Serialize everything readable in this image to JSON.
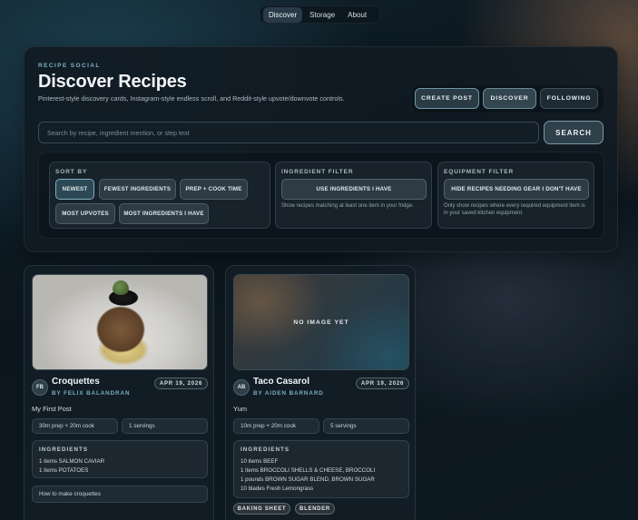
{
  "nav": {
    "items": [
      "Discover",
      "Storage",
      "About"
    ],
    "active": "Discover"
  },
  "hero": {
    "eyebrow": "RECIPE SOCIAL",
    "title": "Discover Recipes",
    "subtitle": "Pinterest-style discovery cards, Instagram-style endless scroll, and Reddit-style upvote/downvote controls.",
    "actions": {
      "create": "CREATE POST",
      "discover": "DISCOVER",
      "following": "FOLLOWING"
    },
    "search": {
      "placeholder": "Search by recipe, ingredient mention, or step text",
      "value": "",
      "button": "SEARCH"
    }
  },
  "filters": {
    "sort": {
      "title": "SORT BY",
      "options": [
        "NEWEST",
        "FEWEST INGREDIENTS",
        "PREP + COOK TIME",
        "MOST UPVOTES",
        "MOST INGREDIENTS I HAVE"
      ],
      "active": "NEWEST"
    },
    "ingredient": {
      "title": "INGREDIENT FILTER",
      "button": "USE INGREDIENTS I HAVE",
      "help": "Show recipes matching at least one item in your fridge."
    },
    "equipment": {
      "title": "EQUIPMENT FILTER",
      "button": "HIDE RECIPES NEEDING GEAR I DON'T HAVE",
      "help": "Only show recipes where every required equipment item is in your saved kitchen equipment."
    }
  },
  "recipes": [
    {
      "title": "Croquettes",
      "author": "BY FELIX BALANDRAN",
      "initials": "FB",
      "date": "APR 19, 2026",
      "caption": "My First Post",
      "time": "30m prep + 20m cook",
      "servings": "1 servings",
      "ingredients_title": "INGREDIENTS",
      "ingredients": [
        "1 items SALMON CAVIAR",
        "1 items POTATOES"
      ],
      "steps": "How to make croquettes",
      "image": "photo"
    },
    {
      "title": "Taco Casarol",
      "author": "BY AIDEN BARNARD",
      "initials": "AB",
      "date": "APR 19, 2026",
      "caption": "Yum",
      "time": "10m prep + 20m cook",
      "servings": "5 servings",
      "ingredients_title": "INGREDIENTS",
      "ingredients": [
        "10 items BEEF",
        "1 items BROCCOLI SHELLS & CHEESE, BROCCOLI",
        "1 pounds BROWN SUGAR BLEND, BROWN SUGAR",
        "10 blades Fresh Lemongrass"
      ],
      "no_image_label": "NO IMAGE YET",
      "equipment": [
        "BAKING SHEET",
        "BLENDER"
      ]
    }
  ],
  "colors": {
    "accent": "#7fb3c0",
    "background": "#0b151d",
    "panel": "#101a23"
  }
}
